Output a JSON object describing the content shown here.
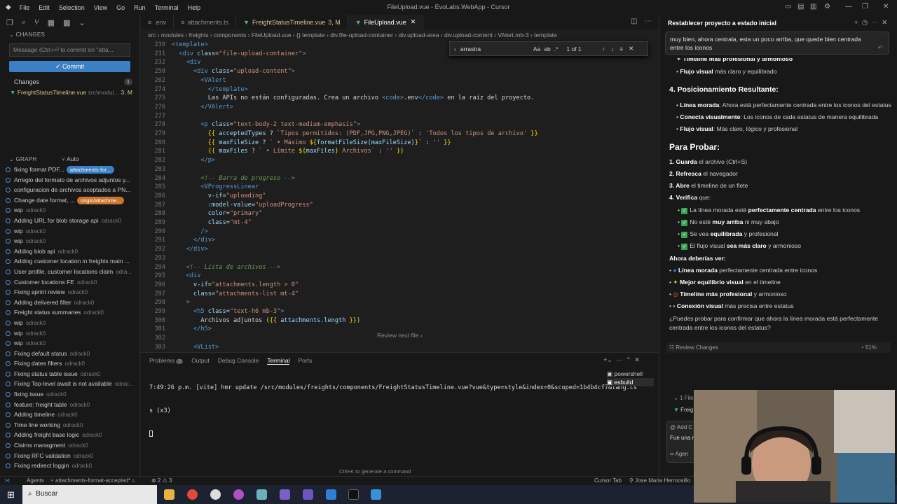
{
  "titlebar": {
    "menu": [
      "File",
      "Edit",
      "Selection",
      "View",
      "Go",
      "Run",
      "Terminal",
      "Help"
    ],
    "title": "FileUpload.vue - EvoLabs.WebApp - Cursor"
  },
  "sidebar": {
    "changes_header": "CHANGES",
    "message_placeholder": "Message (Ctrl+⏎ to commit on \"atta...",
    "commit_label": "✓  Commit",
    "changes_label": "Changes",
    "changes_count": "1",
    "changed_file": "FreightStatusTimeline.vue",
    "changed_path": "src\\modul...",
    "changed_status": "3, M",
    "graph_header": "GRAPH",
    "graph_auto": "Auto",
    "commits": [
      {
        "msg": "fixing format PDF...",
        "tag": "attachments-for...",
        "tagcolor": "#3b7fc4"
      },
      {
        "msg": "Arreglo del formato de archivos adjuntos y...",
        "author": ""
      },
      {
        "msg": "configuracion de archivos aceptados a PN...",
        "author": ""
      },
      {
        "msg": "Change date format, ...",
        "tag": "origin/attachme...",
        "tagcolor": "#c9732d"
      },
      {
        "msg": "wip",
        "author": "odrack0"
      },
      {
        "msg": "Adding URL for blob storage api",
        "author": "odrack0"
      },
      {
        "msg": "wip",
        "author": "odrack0"
      },
      {
        "msg": "wip",
        "author": "odrack0"
      },
      {
        "msg": "Adding blob api",
        "author": "odrack0"
      },
      {
        "msg": "Adding customer location in freights main ...",
        "author": ""
      },
      {
        "msg": "User profile, customer locations claim",
        "author": "odra..."
      },
      {
        "msg": "Customer locations FE",
        "author": "odrack0"
      },
      {
        "msg": "Fixing sprint review",
        "author": "odrack0"
      },
      {
        "msg": "Adding delivered filter",
        "author": "odrack0"
      },
      {
        "msg": "Freight status summaries",
        "author": "odrack0"
      },
      {
        "msg": "wip",
        "author": "odrack0"
      },
      {
        "msg": "wip",
        "author": "odrack0"
      },
      {
        "msg": "wip",
        "author": "odrack0"
      },
      {
        "msg": "Fixing default status",
        "author": "odrack0"
      },
      {
        "msg": "Fixing dates filters",
        "author": "odrack0"
      },
      {
        "msg": "Fixing status  table issue",
        "author": "odrack0"
      },
      {
        "msg": "Fixing Top-level await is not available",
        "author": "odrac..."
      },
      {
        "msg": "fixing issue",
        "author": "odrack0"
      },
      {
        "msg": "feature: freight table",
        "author": "odrack0"
      },
      {
        "msg": "Adding timeline",
        "author": "odrack0"
      },
      {
        "msg": "Time line working",
        "author": "odrack0"
      },
      {
        "msg": "Adding freight base logic",
        "author": "odrack0"
      },
      {
        "msg": "Claims managment",
        "author": "odrack0"
      },
      {
        "msg": "Fixing RFC validation",
        "author": "odrack0"
      },
      {
        "msg": "Fixing redirect loggin",
        "author": "odrack0"
      }
    ]
  },
  "tabs": [
    {
      "label": ".env",
      "mod": "",
      "active": false
    },
    {
      "label": "attachments.ts",
      "mod": "",
      "active": false
    },
    {
      "label": "FreightStatusTimeline.vue",
      "mod": "3, M",
      "active": false
    },
    {
      "label": "FileUpload.vue",
      "mod": "",
      "active": true
    }
  ],
  "breadcrumb": "src › modules › freights › components › FileUpload.vue › {} template › div.file-upload-container › div.upload-area › div.upload-content › VAlert.mb-3 › template",
  "find": {
    "value": "arrastra",
    "result": "1 of 1"
  },
  "code_lines": [
    {
      "n": "230",
      "html": "<span class='tg'>&lt;template&gt;</span>"
    },
    {
      "n": "231",
      "html": "  <span class='tg'>&lt;div</span> <span class='at'>class</span>=<span class='st'>\"file-upload-container\"</span><span class='tg'>&gt;</span>"
    },
    {
      "n": "232",
      "html": "    <span class='tg'>&lt;div</span>"
    },
    {
      "n": "250",
      "html": "      <span class='tg'>&lt;div</span> <span class='at'>class</span>=<span class='st'>\"upload-content\"</span><span class='tg'>&gt;</span>"
    },
    {
      "n": "262",
      "html": "        <span class='tg'>&lt;VAlert</span>"
    },
    {
      "n": "274",
      "html": "          <span class='tg'>&lt;/template&gt;</span>"
    },
    {
      "n": "275",
      "html": "          Las APIs no están configuradas. Crea un archivo <span class='tg'>&lt;code&gt;</span>.env<span class='tg'>&lt;/code&gt;</span> en la raíz del proyecto."
    },
    {
      "n": "276",
      "html": "        <span class='tg'>&lt;/VAlert&gt;</span>"
    },
    {
      "n": "277",
      "html": ""
    },
    {
      "n": "278",
      "html": "        <span class='tg'>&lt;p</span> <span class='at'>class</span>=<span class='st'>\"text-body-2 text-medium-emphasis\"</span><span class='tg'>&gt;</span>"
    },
    {
      "n": "279",
      "html": "          <span class='br'>{{</span> <span class='at'>acceptedTypes</span> ? <span class='st'>`Tipos permitidos: (PDF,JPG,PNG,JPEG)`</span> : <span class='st'>'Todos los tipos de archivo'</span> <span class='br'>}}</span>"
    },
    {
      "n": "280",
      "html": "          <span class='br'>{{</span> <span class='at'>maxFileSize</span> ? <span class='st'>` • Máximo </span><span class='br'>${</span><span class='at'>formatFileSize(maxFileSize)</span><span class='br'>}</span><span class='st'>`</span> : <span class='st'>''</span> <span class='br'>}}</span>"
    },
    {
      "n": "281",
      "html": "          <span class='br'>{{</span> <span class='at'>maxFiles</span> ? <span class='st'>` • Límite </span><span class='br'>${</span><span class='at'>maxFiles</span><span class='br'>}</span><span class='st'> Archivos`</span> : <span class='st'>''</span> <span class='br'>}}</span>"
    },
    {
      "n": "282",
      "html": "        <span class='tg'>&lt;/p&gt;</span>"
    },
    {
      "n": "283",
      "html": ""
    },
    {
      "n": "284",
      "html": "        <span class='cm'>&lt;!-- Barra de progreso --&gt;</span>"
    },
    {
      "n": "285",
      "html": "        <span class='tg'>&lt;VProgressLinear</span>"
    },
    {
      "n": "286",
      "html": "          <span class='at'>v-if</span>=<span class='st'>\"uploading\"</span>"
    },
    {
      "n": "287",
      "html": "          <span class='at'>:model-value</span>=<span class='st'>\"uploadProgress\"</span>"
    },
    {
      "n": "288",
      "html": "          <span class='at'>color</span>=<span class='st'>\"primary\"</span>"
    },
    {
      "n": "289",
      "html": "          <span class='at'>class</span>=<span class='st'>\"mt-4\"</span>"
    },
    {
      "n": "290",
      "html": "        <span class='tg'>/&gt;</span>"
    },
    {
      "n": "291",
      "html": "      <span class='tg'>&lt;/div&gt;</span>"
    },
    {
      "n": "292",
      "html": "    <span class='tg'>&lt;/div&gt;</span>"
    },
    {
      "n": "293",
      "html": ""
    },
    {
      "n": "294",
      "html": "    <span class='cm'>&lt;!-- Lista de archivos --&gt;</span>"
    },
    {
      "n": "295",
      "html": "    <span class='tg'>&lt;div</span>"
    },
    {
      "n": "296",
      "html": "      <span class='at'>v-if</span>=<span class='st'>\"attachments.length &gt; 0\"</span>"
    },
    {
      "n": "297",
      "html": "      <span class='at'>class</span>=<span class='st'>\"attachments-list mt-4\"</span>"
    },
    {
      "n": "298",
      "html": "    <span class='tg'>&gt;</span>"
    },
    {
      "n": "299",
      "html": "      <span class='tg'>&lt;h5</span> <span class='at'>class</span>=<span class='st'>\"text-h6 mb-3\"</span><span class='tg'>&gt;</span>"
    },
    {
      "n": "300",
      "html": "        Archivos adjuntos (<span class='br'>{{</span> <span class='at'>attachments.length</span> <span class='br'>}}</span>)"
    },
    {
      "n": "301",
      "html": "      <span class='tg'>&lt;/h5&gt;</span>"
    },
    {
      "n": "302",
      "html": ""
    },
    {
      "n": "303",
      "html": "      <span class='tg'>&lt;VList&gt;</span>"
    }
  ],
  "review_next": "Review next file ›",
  "panel": {
    "tabs": [
      "Problems",
      "Output",
      "Debug Console",
      "Terminal",
      "Ports"
    ],
    "problems_count": "3",
    "terminal_line1": "7:49:26 p.m. [vite] hmr update /src/modules/freights/components/FreightStatusTimeline.vue?vue&type=style&index=0&scoped=1b4b4cf7&lang.cs",
    "terminal_line2": "s (x3)",
    "shells": [
      "powershell",
      "esbuild"
    ],
    "hint": "Ctrl+K to generate a command"
  },
  "chat": {
    "title": "Restablecer proyecto a estado inicial",
    "user_msg_1": "muy bien, ahora  centrala, esta un poco arriba, que quede bien centrada",
    "user_msg_2": "entre los iconos",
    "partial_top": "Timeline más profesional y armonioso",
    "flow_prefix": "Flujo visual",
    "flow_rest": " más claro y equilibrado",
    "h4": "4. Posicionamiento Resultante:",
    "bullets4": [
      {
        "b": "Línea morada",
        "t": ": Ahora está perfectamente centrada entre los iconos del estatus"
      },
      {
        "b": "Conecta visualmente",
        "t": ": Los iconos de cada estatus de manera equilibrada"
      },
      {
        "b": "Flujo visual",
        "t": ": Más claro, lógico y profesional"
      }
    ],
    "h_test": "Para Probar:",
    "steps": [
      {
        "b": "1. Guarda",
        "t": " el archivo (Ctrl+S)"
      },
      {
        "b": "2. Refresca",
        "t": " el navegador"
      },
      {
        "b": "3. Abre",
        "t": " el timeline de un flete"
      },
      {
        "b": "4. Verifica",
        "t": " que:"
      }
    ],
    "checks": [
      {
        "a": "La línea morada esté ",
        "b": "perfectamente centrada",
        "c": " entre los iconos"
      },
      {
        "a": "No esté ",
        "b": "muy arriba",
        "c": " ni muy abajo"
      },
      {
        "a": "Se vea ",
        "b": "equilibrada",
        "c": " y profesional"
      },
      {
        "a": "El flujo visual ",
        "b": "sea más claro",
        "c": " y armonioso"
      }
    ],
    "now_label": "Ahora deberías ver:",
    "expect": [
      {
        "icon": "●",
        "color": "#3b7fc4",
        "b": "Línea morada",
        "t": " perfectamente centrada entre iconos"
      },
      {
        "icon": "✦",
        "color": "#e8c547",
        "b": "Mejor equilibrio visual",
        "t": " en el timeline"
      },
      {
        "icon": "◎",
        "color": "#e05a3a",
        "b": "Timeline más profesional",
        "t": " y armonioso"
      },
      {
        "icon": "•",
        "color": "#cfcfcf",
        "b": "Conexión visual",
        "t": " más precisa entre estatus"
      }
    ],
    "question_1": "¿Puedes probar para confirmar que ahora la línea morada está perfectamente",
    "question_2": "centrada entre los iconos del estatus?",
    "review_changes": "Review Changes",
    "progress": "51%",
    "files_label": "1 File",
    "file_short": "Freig",
    "add_context": "Add C",
    "draft": "Fue una r",
    "agent": "Agen"
  },
  "statusbar": {
    "left": "Agents",
    "branch": "attachments-format-accepted*",
    "errors": "⊗ 2 ⚠ 3",
    "cursor_tab": "Cursor Tab",
    "user": "Jose Maria Hermosillo"
  },
  "taskbar": {
    "search": "Buscar"
  }
}
